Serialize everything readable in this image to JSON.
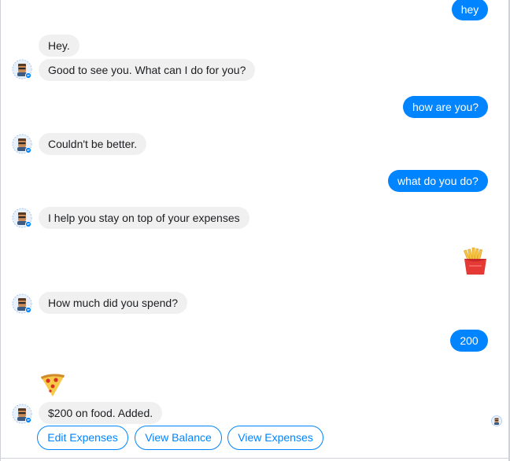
{
  "conversation": {
    "messages": [
      {
        "from": "user",
        "text": "hey"
      },
      {
        "from": "bot",
        "text": "Hey."
      },
      {
        "from": "bot",
        "text": "Good to see you. What can I do for you?"
      },
      {
        "from": "user",
        "text": "how are you?"
      },
      {
        "from": "bot",
        "text": "Couldn't be better."
      },
      {
        "from": "user",
        "text": "what do you do?"
      },
      {
        "from": "bot",
        "text": "I help you stay on top of your expenses"
      },
      {
        "from": "user",
        "sticker": "fries-emoji"
      },
      {
        "from": "bot",
        "text": "How much did you spend?"
      },
      {
        "from": "user",
        "text": "200"
      },
      {
        "from": "bot",
        "sticker": "pizza-emoji"
      },
      {
        "from": "bot",
        "text": "$200 on food. Added."
      }
    ]
  },
  "quick_replies": [
    "Edit Expenses",
    "View Balance",
    "View Expenses"
  ],
  "colors": {
    "user_bubble": "#0084ff",
    "bot_bubble": "#f1f0f0",
    "quick_reply_border": "#0084ff"
  }
}
